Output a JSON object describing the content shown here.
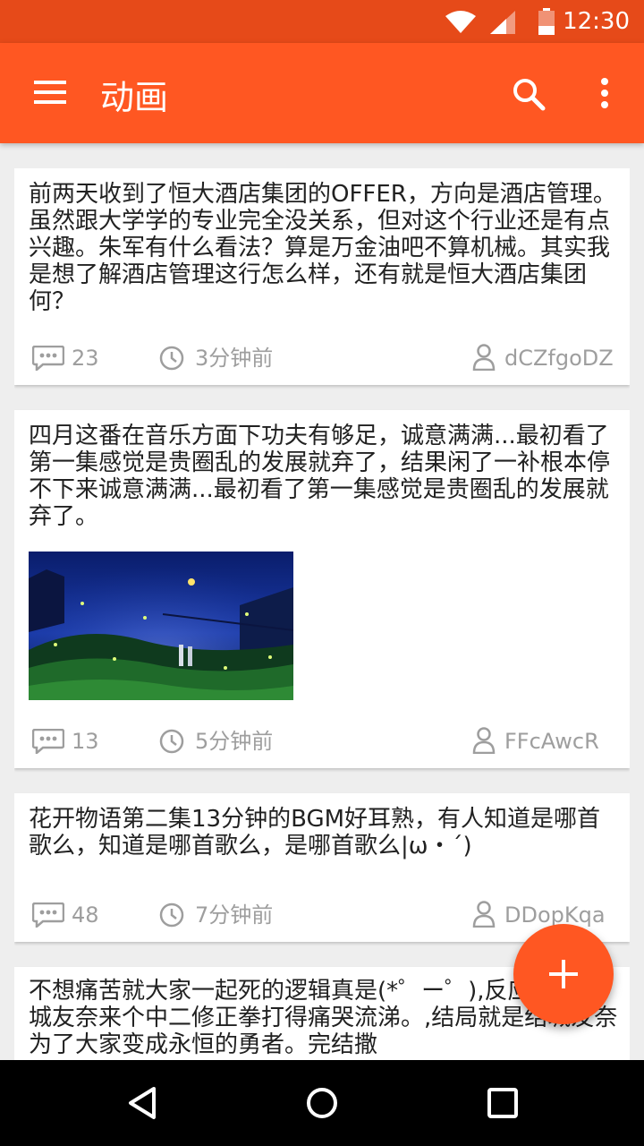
{
  "status_bar": {
    "time": "12:30"
  },
  "app_bar": {
    "title": "动画"
  },
  "posts": [
    {
      "text": "前两天收到了恒大酒店集团的OFFER，方向是酒店管理。虽然跟大学学的专业完全没关系，但对这个行业还是有点兴趣。朱军有什么看法？算是万金油吧不算机械。其实我是想了解酒店管理这行怎么样，还有就是恒大酒店集团何？",
      "comments": "23",
      "time": "3分钟前",
      "author": "dCZfgoDZ"
    },
    {
      "text": "四月这番在音乐方面下功夫有够足，诚意满满...最初看了第一集感觉是贵圈乱的发展就弃了，结果闲了一补根本停不下来诚意满满...最初看了第一集感觉是贵圈乱的发展就弃了。",
      "comments": "13",
      "time": "5分钟前",
      "author": "FFcAwcR"
    },
    {
      "text": "花开物语第二集13分钟的BGM好耳熟，有人知道是哪首歌么，知道是哪首歌么，是哪首歌么|ω・´)",
      "comments": "48",
      "time": "7分钟前",
      "author": "DDopKqa"
    },
    {
      "text": "不想痛苦就大家一起死的逻辑真是(*゜ー゜),反应该是结城友奈来个中二修正拳打得痛哭流涕。,结局就是结城友奈为了大家变成永恒的勇者。完结撒"
    }
  ],
  "fab": {
    "icon": "plus-icon"
  },
  "colors": {
    "primary": "#ff5722",
    "primary_dark": "#e64a19",
    "meta": "#9e9e9e"
  }
}
